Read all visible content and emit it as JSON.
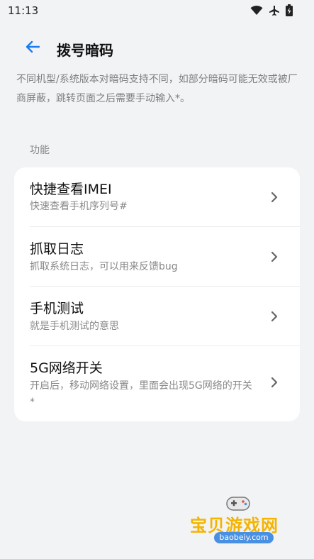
{
  "status_bar": {
    "time": "11:13",
    "icons": [
      "wifi-icon",
      "airplane-icon",
      "battery-charging-icon"
    ]
  },
  "header": {
    "back_icon": "arrow-left-icon",
    "title": "拨号暗码"
  },
  "notice": "不同机型/系统版本对暗码支持不同，如部分暗码可能无效或被厂商屏蔽，跳转页面之后需要手动输入*。",
  "section": {
    "label": "功能"
  },
  "items": [
    {
      "title": "快捷查看IMEI",
      "subtitle": "快速查看手机序列号#"
    },
    {
      "title": "抓取日志",
      "subtitle": "抓取系统日志，可以用来反馈bug"
    },
    {
      "title": "手机测试",
      "subtitle": "就是手机测试的意思"
    },
    {
      "title": "5G网络开关",
      "subtitle": "开启后，移动网络设置，里面会出现5G网络的开关*"
    }
  ],
  "watermark": {
    "text": "宝贝游戏网",
    "url": "baobeiy.com"
  },
  "colors": {
    "accent": "#1a7cf0",
    "background": "#f2f3f5",
    "card": "#ffffff",
    "secondary_text": "#888888"
  }
}
